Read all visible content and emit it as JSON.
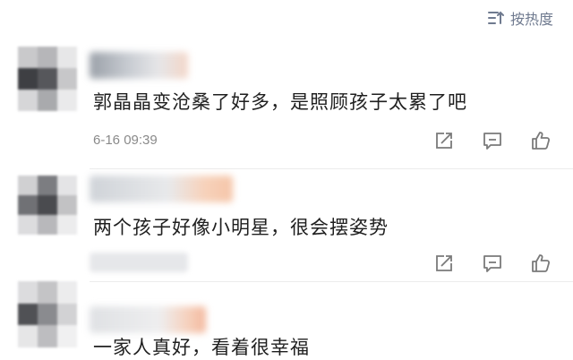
{
  "sort": {
    "label": "按热度",
    "icon": "sort-lines-icon"
  },
  "comments": [
    {
      "text": "郭晶晶变沧桑了好多，是照顾孩子太累了吧",
      "time": "6-16 09:39"
    },
    {
      "text": "两个孩子好像小明星，很会摆姿势"
    },
    {
      "text": "一家人真好，看着很幸福"
    }
  ],
  "colors": {
    "accent": "#6f7a8f",
    "icon": "#7a7a7a"
  }
}
